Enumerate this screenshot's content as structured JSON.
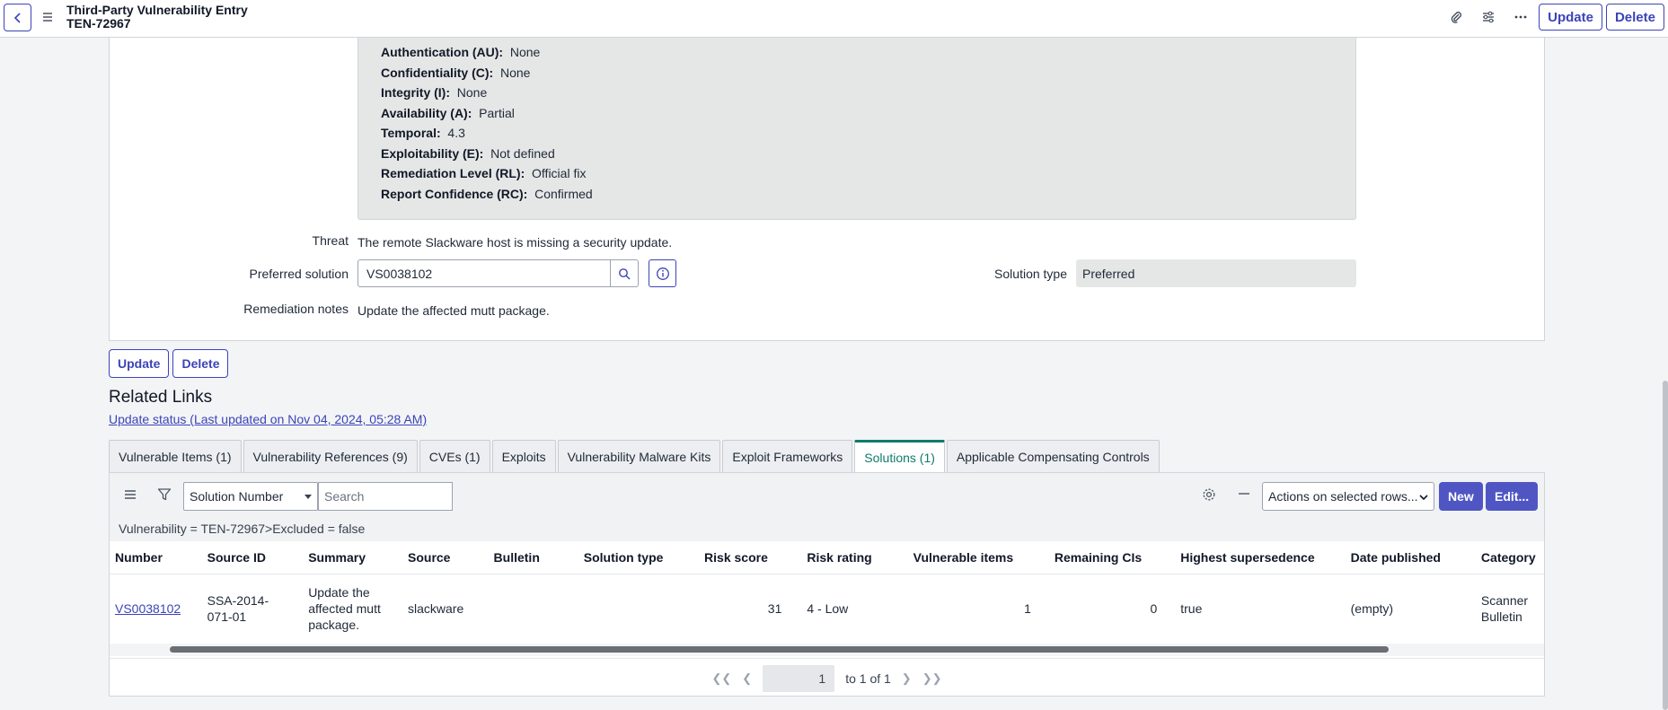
{
  "header": {
    "title_line1": "Third-Party Vulnerability Entry",
    "title_line2": "TEN-72967",
    "update_label": "Update",
    "delete_label": "Delete"
  },
  "cvss": [
    {
      "label": "Authentication (AU):",
      "value": "None"
    },
    {
      "label": "Confidentiality (C):",
      "value": "None"
    },
    {
      "label": "Integrity (I):",
      "value": "None"
    },
    {
      "label": "Availability (A):",
      "value": "Partial"
    },
    {
      "label": "Temporal:",
      "value": "4.3"
    },
    {
      "label": "Exploitability (E):",
      "value": "Not defined"
    },
    {
      "label": "Remediation Level (RL):",
      "value": "Official fix"
    },
    {
      "label": "Report Confidence (RC):",
      "value": "Confirmed"
    }
  ],
  "form": {
    "threat_label": "Threat",
    "threat_value": "The remote Slackware host is missing a security update.",
    "preferred_solution_label": "Preferred solution",
    "preferred_solution_value": "VS0038102",
    "solution_type_label": "Solution type",
    "solution_type_value": "Preferred",
    "remediation_label": "Remediation notes",
    "remediation_value": "Update the affected mutt package.",
    "update_label": "Update",
    "delete_label": "Delete"
  },
  "related": {
    "title": "Related Links",
    "status_link": "Update status (Last updated on Nov 04, 2024, 05:28 AM)",
    "tabs": [
      "Vulnerable Items (1)",
      "Vulnerability References (9)",
      "CVEs (1)",
      "Exploits",
      "Vulnerability Malware Kits",
      "Exploit Frameworks",
      "Solutions (1)",
      "Applicable Compensating Controls"
    ],
    "active_tab": "Solutions (1)"
  },
  "list": {
    "search_field": "Solution Number",
    "search_placeholder": "Search",
    "actions_label": "Actions on selected rows...",
    "new_label": "New",
    "edit_label": "Edit...",
    "filter_text": "Vulnerability = TEN-72967>Excluded = false",
    "columns": [
      "Number",
      "Source ID",
      "Summary",
      "Source",
      "Bulletin",
      "Solution type",
      "Risk score",
      "Risk rating",
      "Vulnerable items",
      "Remaining CIs",
      "Highest supersedence",
      "Date published",
      "Category"
    ],
    "row": {
      "number": "VS0038102",
      "source_id": "SSA-2014-071-01",
      "summary": "Update the affected mutt package.",
      "source": "slackware",
      "bulletin": "",
      "solution_type": "",
      "risk_score": "31",
      "risk_rating": "4 - Low",
      "vulnerable_items": "1",
      "remaining_cis": "0",
      "highest_supersedence": "true",
      "date_published": "(empty)",
      "category": "Scanner Bulletin"
    },
    "pager_value": "1",
    "pager_text": "to 1 of 1"
  },
  "colors": {
    "accent": "#3b44b8",
    "active_tab": "#0f7b6c"
  }
}
